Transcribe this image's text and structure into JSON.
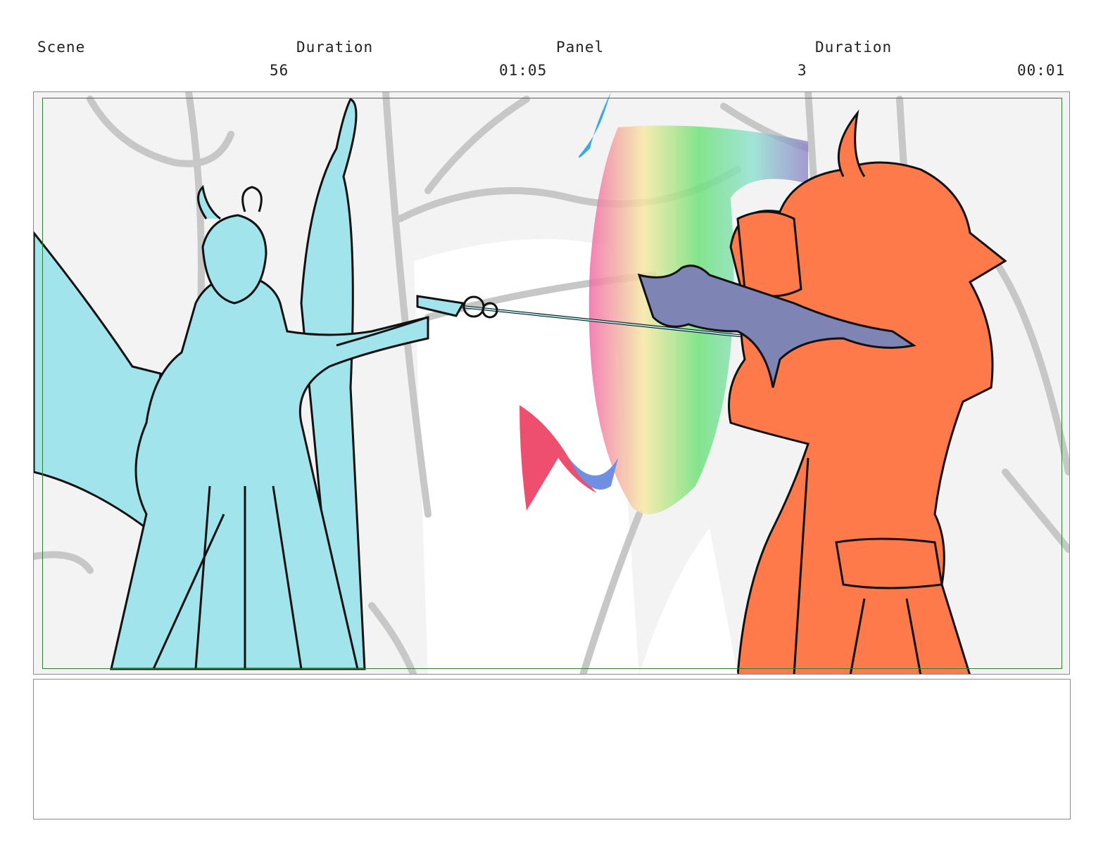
{
  "header": {
    "scene_label": "Scene",
    "scene_duration_label": "Duration",
    "panel_label": "Panel",
    "panel_duration_label": "Duration",
    "scene_number": "56",
    "scene_duration": "01:05",
    "panel_number": "3",
    "panel_duration": "00:01"
  },
  "colors": {
    "left_character": "#a1e4ec",
    "right_character": "#ff7a4a",
    "creature": "#7e84b4",
    "safe_area_border": "#2e7d32",
    "background_sketch": "#c7c7c7"
  },
  "notes": {
    "text": ""
  }
}
